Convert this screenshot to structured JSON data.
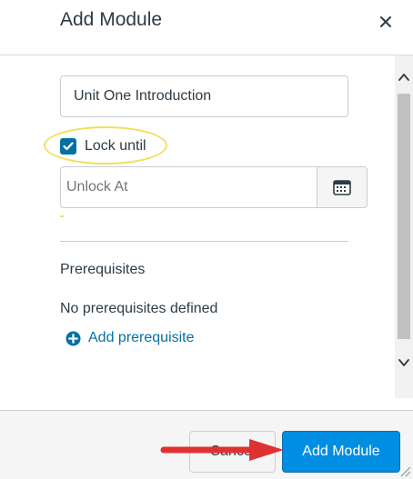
{
  "dialog": {
    "title": "Add Module",
    "close_symbol": "×"
  },
  "form": {
    "module_name_value": "Unit One Introduction",
    "lock_until_label": "Lock until",
    "lock_until_checked": true,
    "unlock_at_placeholder": "Unlock At",
    "prerequisites_heading": "Prerequisites",
    "no_prerequisites_text": "No prerequisites defined",
    "add_prerequisite_label": "Add prerequisite"
  },
  "footer": {
    "cancel_label": "Cancel",
    "add_module_label": "Add Module"
  },
  "icons": {
    "close": "close-icon",
    "checkbox_check": "checkmark-icon",
    "calendar": "calendar-icon",
    "add": "plus-circle-icon",
    "scroll_up": "chevron-up-icon",
    "scroll_down": "chevron-down-icon",
    "annotation_arrow": "arrow-right-icon",
    "resize": "resize-grip-icon"
  },
  "colors": {
    "accent": "#008ee2",
    "link": "#0770a3",
    "highlight": "#f2df5e",
    "arrow": "#e03131"
  }
}
